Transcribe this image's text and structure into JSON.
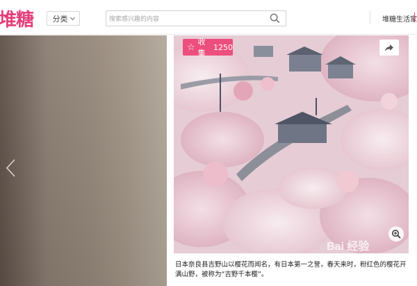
{
  "header": {
    "logo": "堆糖",
    "category_label": "分类",
    "search_placeholder": "搜索感兴趣的内容",
    "right_link": "堆糖生活家"
  },
  "photo": {
    "collect_label": "收集",
    "collect_count": "1250",
    "watermark_text": "Bai 经验"
  },
  "caption": "日本奈良县吉野山以樱花而闻名，有日本第一之誉，春天来时，粉红色的樱花开满山野，被称为“吉野千本樱”。",
  "colors": {
    "brand": "#e3407b",
    "collect_button": "#ec4f7d"
  },
  "icons": [
    "chevron-down-icon",
    "search-icon",
    "star-icon",
    "share-icon",
    "zoom-icon",
    "left-arrow-icon"
  ]
}
